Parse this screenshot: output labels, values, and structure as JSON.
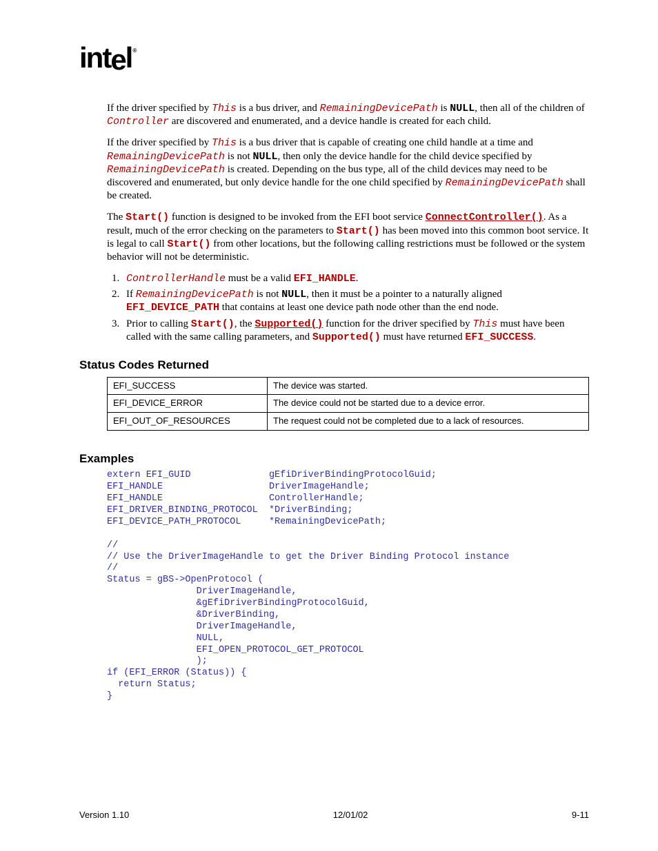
{
  "logo_text": "intel",
  "para1": {
    "t1": "If the driver specified by ",
    "this": "This",
    "t2": " is a bus driver, and ",
    "rdp": "RemainingDevicePath",
    "t3": " is ",
    "null": "NULL",
    "t4": ", then all of the children of ",
    "ctrl": "Controller",
    "t5": " are discovered and enumerated, and a device handle is created for each child."
  },
  "para2": {
    "t1": "If the driver specified by ",
    "this": "This",
    "t2": " is a bus driver that is capable of creating one child handle at a time and ",
    "rdp1": "RemainingDevicePath",
    "t3": " is not ",
    "null": "NULL",
    "t4": ", then only the device handle for the child device specified by ",
    "rdp2": "RemainingDevicePath",
    "t5": " is created.  Depending on the bus type, all of the child devices may need to be discovered and enumerated, but only device handle for the one child specified by ",
    "rdp3": "RemainingDevicePath",
    "t6": " shall be created."
  },
  "para3": {
    "t1": "The ",
    "start1": "Start()",
    "t2": " function is designed to be invoked from the EFI boot service ",
    "cc": "ConnectController()",
    "t3": ".  As a result, much of the error checking on the parameters to ",
    "start2": "Start()",
    "t4": " has been moved into this common boot service.  It is legal to call ",
    "start3": "Start()",
    "t5": " from other locations, but the following calling restrictions must be followed or the system behavior will not be deterministic."
  },
  "list": {
    "i1": {
      "ch": "ControllerHandle",
      "t1": " must be a valid ",
      "eh": "EFI_HANDLE",
      "t2": "."
    },
    "i2": {
      "t1": "If ",
      "rdp": "RemainingDevicePath",
      "t2": " is not ",
      "null": "NULL",
      "t3": ", then it must be a pointer to a naturally aligned ",
      "edp": "EFI_DEVICE_PATH",
      "t4": " that contains at least one device path node other than the end node."
    },
    "i3": {
      "t1": "Prior to calling ",
      "start": "Start()",
      "t2": ", the ",
      "sup1": "Supported()",
      "t3": " function for the driver specified by ",
      "this": "This",
      "t4": " must have been called with the same calling parameters, and ",
      "sup2": "Supported()",
      "t5": " must have returned ",
      "es": "EFI_SUCCESS",
      "t6": "."
    }
  },
  "heading_status": "Status Codes Returned",
  "table": [
    {
      "code": "EFI_SUCCESS",
      "desc": "The device was started."
    },
    {
      "code": "EFI_DEVICE_ERROR",
      "desc": "The device could not be started due to a device error."
    },
    {
      "code": "EFI_OUT_OF_RESOURCES",
      "desc": "The request could not be completed due to a lack of resources."
    }
  ],
  "heading_examples": "Examples",
  "code": "extern EFI_GUID              gEfiDriverBindingProtocolGuid;\nEFI_HANDLE                   DriverImageHandle;\nEFI_HANDLE                   ControllerHandle;\nEFI_DRIVER_BINDING_PROTOCOL  *DriverBinding;\nEFI_DEVICE_PATH_PROTOCOL     *RemainingDevicePath;\n\n//\n// Use the DriverImageHandle to get the Driver Binding Protocol instance\n//\nStatus = gBS->OpenProtocol (\n                DriverImageHandle,\n                &gEfiDriverBindingProtocolGuid,\n                &DriverBinding,\n                DriverImageHandle,\n                NULL,\n                EFI_OPEN_PROTOCOL_GET_PROTOCOL\n                );\nif (EFI_ERROR (Status)) {\n  return Status;\n}",
  "footer": {
    "left": "Version 1.10",
    "center": "12/01/02",
    "right": "9-11"
  }
}
